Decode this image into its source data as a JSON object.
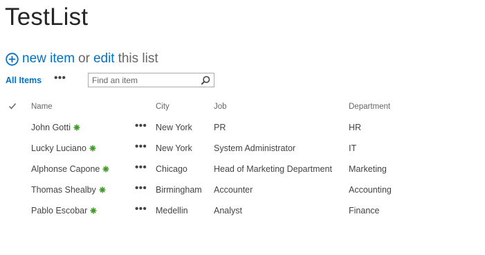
{
  "page": {
    "title": "TestList"
  },
  "actions": {
    "new_item_label": "new item",
    "or_text": "or",
    "edit_label": "edit",
    "after_text": "this list"
  },
  "views": {
    "active_view": "All Items",
    "more_label": "•••"
  },
  "search": {
    "placeholder": "Find an item"
  },
  "columns": {
    "name": "Name",
    "city": "City",
    "job": "Job",
    "department": "Department"
  },
  "rows": [
    {
      "name": "John Gotti",
      "city": "New York",
      "job": "PR",
      "department": "HR"
    },
    {
      "name": "Lucky Luciano",
      "city": "New York",
      "job": "System Administrator",
      "department": "IT"
    },
    {
      "name": "Alphonse Capone",
      "city": "Chicago",
      "job": "Head of Marketing Department",
      "department": "Marketing"
    },
    {
      "name": "Thomas Shealby",
      "city": "Birmingham",
      "job": "Accounter",
      "department": "Accounting"
    },
    {
      "name": "Pablo Escobar",
      "city": "Medellin",
      "job": "Analyst",
      "department": "Finance"
    }
  ],
  "row_menu_label": "•••",
  "colors": {
    "link": "#0072c6",
    "new_badge": "#3f9b24",
    "text": "#444444"
  }
}
